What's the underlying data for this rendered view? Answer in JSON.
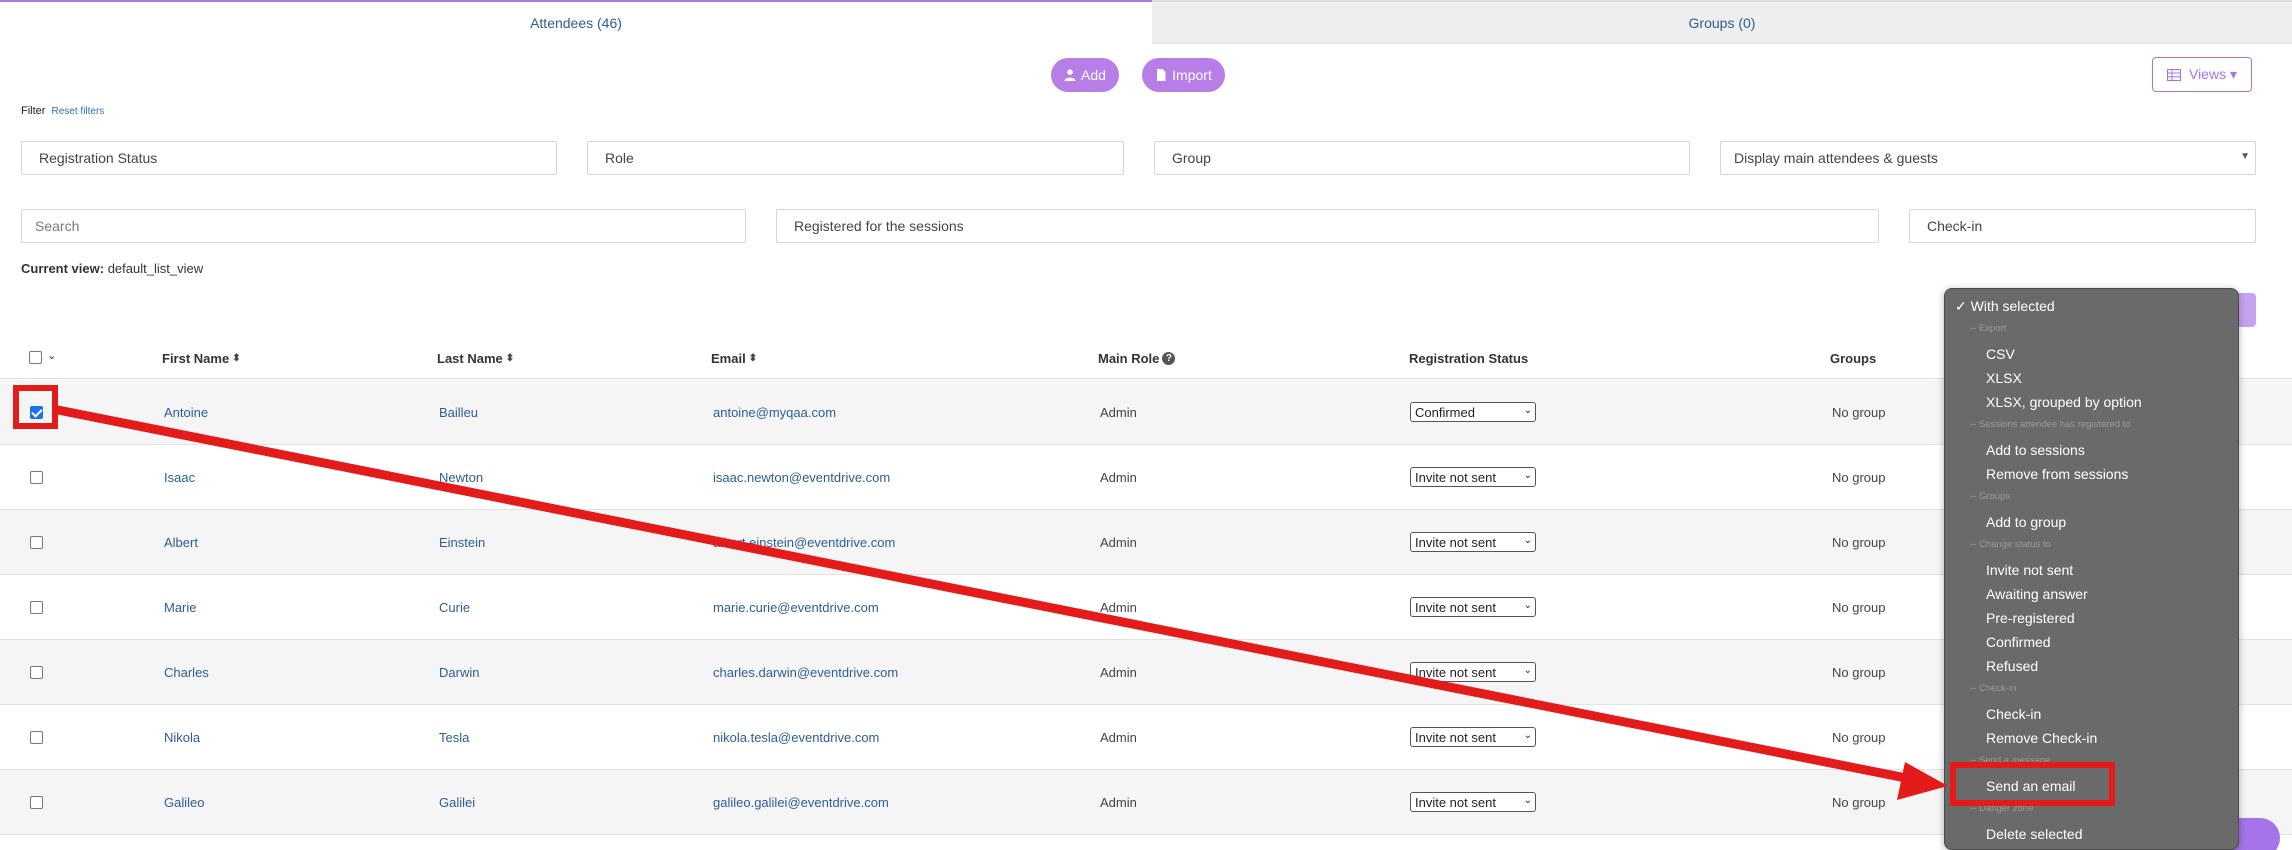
{
  "tabs": {
    "attendees": "Attendees (46)",
    "groups": "Groups (0)"
  },
  "toolbar": {
    "add_label": "Add",
    "import_label": "Import",
    "views_label": "Views"
  },
  "filter": {
    "label": "Filter",
    "reset_label": "Reset filters"
  },
  "filters_row1": {
    "registration_status": "Registration Status",
    "role": "Role",
    "group": "Group",
    "display_select": "Display main attendees & guests"
  },
  "filters_row2": {
    "search_placeholder": "Search",
    "sessions": "Registered for the sessions",
    "checkin": "Check-in"
  },
  "current_view": {
    "label": "Current view:",
    "value": "default_list_view"
  },
  "table": {
    "headers": {
      "first_name": "First Name",
      "last_name": "Last Name",
      "email": "Email",
      "main_role": "Main Role",
      "registration_status": "Registration Status",
      "groups": "Groups"
    },
    "rows": [
      {
        "first": "Antoine",
        "last": "Bailleu",
        "email": "antoine@myqaa.com",
        "role": "Admin",
        "status": "Confirmed",
        "group": "No group",
        "checked": true
      },
      {
        "first": "Isaac",
        "last": "Newton",
        "email": "isaac.newton@eventdrive.com",
        "role": "Admin",
        "status": "Invite not sent",
        "group": "No group",
        "checked": false
      },
      {
        "first": "Albert",
        "last": "Einstein",
        "email": "albert.einstein@eventdrive.com",
        "role": "Admin",
        "status": "Invite not sent",
        "group": "No group",
        "checked": false
      },
      {
        "first": "Marie",
        "last": "Curie",
        "email": "marie.curie@eventdrive.com",
        "role": "Admin",
        "status": "Invite not sent",
        "group": "No group",
        "checked": false
      },
      {
        "first": "Charles",
        "last": "Darwin",
        "email": "charles.darwin@eventdrive.com",
        "role": "Admin",
        "status": "Invite not sent",
        "group": "No group",
        "checked": false
      },
      {
        "first": "Nikola",
        "last": "Tesla",
        "email": "nikola.tesla@eventdrive.com",
        "role": "Admin",
        "status": "Invite not sent",
        "group": "No group",
        "checked": false
      },
      {
        "first": "Galileo",
        "last": "Galilei",
        "email": "galileo.galilei@eventdrive.com",
        "role": "Admin",
        "status": "Invite not sent",
        "group": "No group",
        "checked": false
      }
    ]
  },
  "menu": {
    "title": "✓ With selected",
    "export_header": "-- Export",
    "csv": "CSV",
    "xlsx": "XLSX",
    "xlsx_grouped": "XLSX, grouped by option",
    "sessions_header": "-- Sessions attendee has registered to",
    "add_sessions": "Add to sessions",
    "remove_sessions": "Remove from sessions",
    "groups_header": "-- Groups",
    "add_group": "Add to group",
    "status_header": "-- Change status to",
    "invite_not_sent": "Invite not sent",
    "awaiting": "Awaiting answer",
    "preregistered": "Pre-registered",
    "confirmed": "Confirmed",
    "refused": "Refused",
    "checkin_header": "-- Check-in",
    "checkin": "Check-in",
    "remove_checkin": "Remove Check-in",
    "message_header": "-- Send a message",
    "send_email": "Send an email",
    "danger_header": "-- Danger zone",
    "delete_selected": "Delete selected"
  },
  "colors": {
    "accent": "#b77ee8",
    "link": "#2f5c93",
    "annotation": "#e41b1b",
    "menu_bg": "#6a6a6a"
  }
}
